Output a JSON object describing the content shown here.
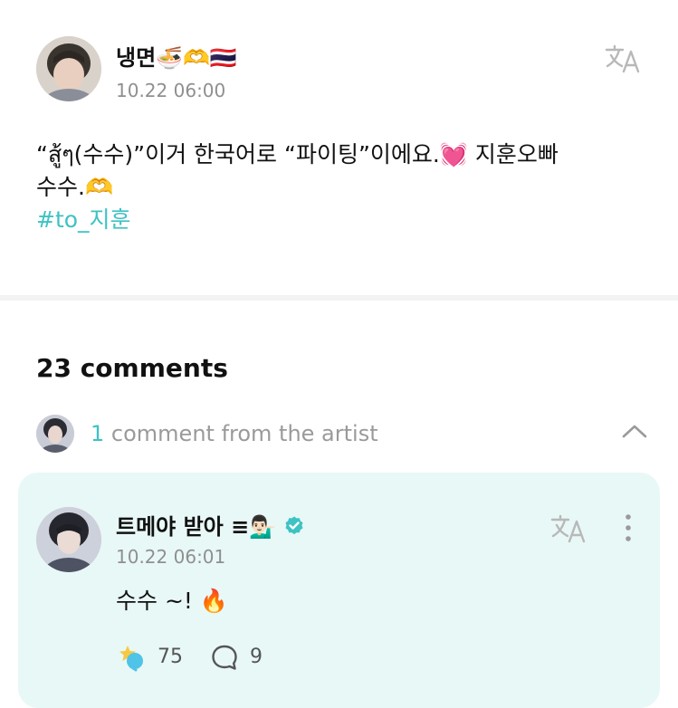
{
  "post": {
    "author_name": "냉면🍜🫶🇹🇭",
    "timestamp": "10.22 06:00",
    "body_line1": "“สู้ๆ(수수)”이거 한국어로 “파이팅”이에요.💓 지훈오빠",
    "body_line2": "수수.🫶",
    "hashtag": "#to_지훈",
    "translate_icon": "translate-icon"
  },
  "comments": {
    "count_label": "23 comments",
    "artist_count": "1",
    "artist_label": " comment from the artist",
    "collapse_icon": "chevron-up-icon"
  },
  "artist_comment": {
    "author_name": "트메야 받아",
    "name_emoji": "≡💁🏻‍♂️",
    "verified_icon": "verified-badge-icon",
    "timestamp": "10.22 06:01",
    "text": "수수 ~! 🔥",
    "like_count": "75",
    "reply_count": "9",
    "more_icon": "more-vertical-icon"
  },
  "colors": {
    "accent": "#3ec2c4",
    "card_bg": "#e8f8f6",
    "muted": "#8f8f8f",
    "divider": "#f2f3f5"
  }
}
